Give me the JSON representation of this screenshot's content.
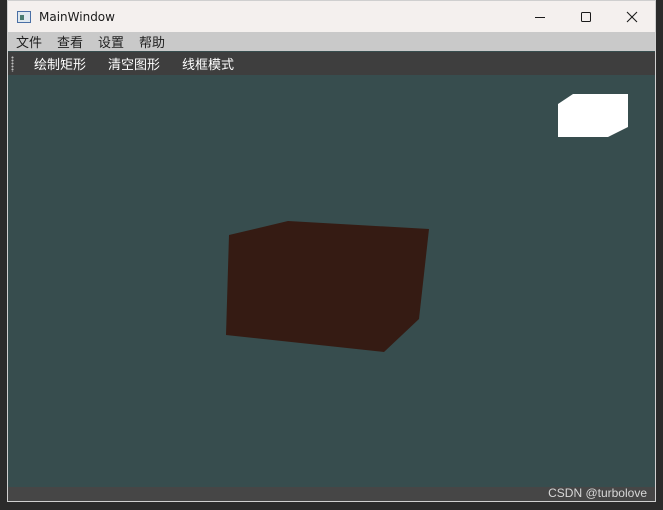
{
  "window": {
    "title": "MainWindow",
    "controls": {
      "minimize": "minimize-icon",
      "maximize": "maximize-icon",
      "close": "close-icon"
    }
  },
  "menubar": {
    "items": [
      {
        "label": "文件"
      },
      {
        "label": "查看"
      },
      {
        "label": "设置"
      },
      {
        "label": "帮助"
      }
    ]
  },
  "toolbar": {
    "items": [
      {
        "label": "绘制矩形"
      },
      {
        "label": "清空图形"
      },
      {
        "label": "线框模式"
      }
    ]
  },
  "viewport": {
    "background": "#374d4e",
    "box_color": "#351b13",
    "minimap_color": "#ffffff"
  },
  "watermark": "CSDN @turbolove"
}
